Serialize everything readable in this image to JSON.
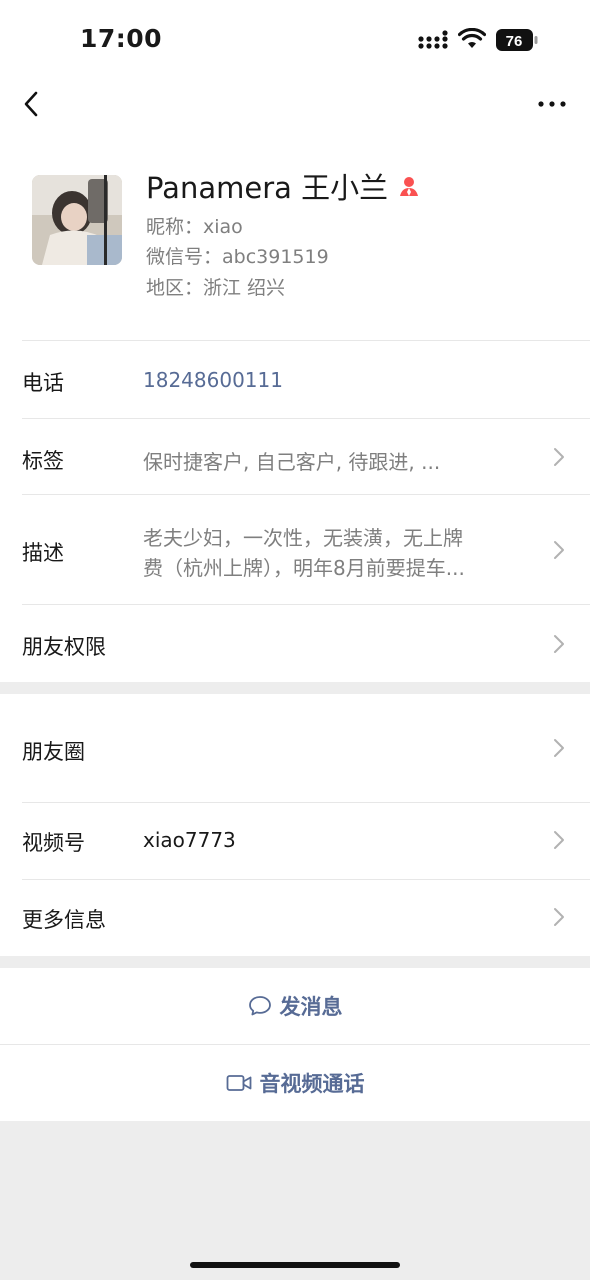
{
  "status": {
    "time": "17:00",
    "battery": "76"
  },
  "profile": {
    "name": "Panamera 王小兰",
    "nickname": "昵称：xiao",
    "wechat_id": "微信号：abc391519",
    "region": "地区：浙江 绍兴",
    "gender_color": "#fa5151"
  },
  "rows": {
    "phone": {
      "label": "电话",
      "value": "18248600111"
    },
    "tags": {
      "label": "标签",
      "value": "保时捷客户, 自己客户, 待跟进, ..."
    },
    "desc": {
      "label": "描述",
      "line1": "老夫少妇，一次性，无装潢，无上牌",
      "line2": "费（杭州上牌），明年8月前要提车..."
    },
    "permissions": {
      "label": "朋友权限"
    },
    "moments": {
      "label": "朋友圈"
    },
    "channels": {
      "label": "视频号",
      "value": "xiao7773"
    },
    "more": {
      "label": "更多信息"
    }
  },
  "actions": {
    "message": "发消息",
    "call": "音视频通话"
  },
  "colors": {
    "link": "#576b95",
    "background": "#ededed"
  }
}
